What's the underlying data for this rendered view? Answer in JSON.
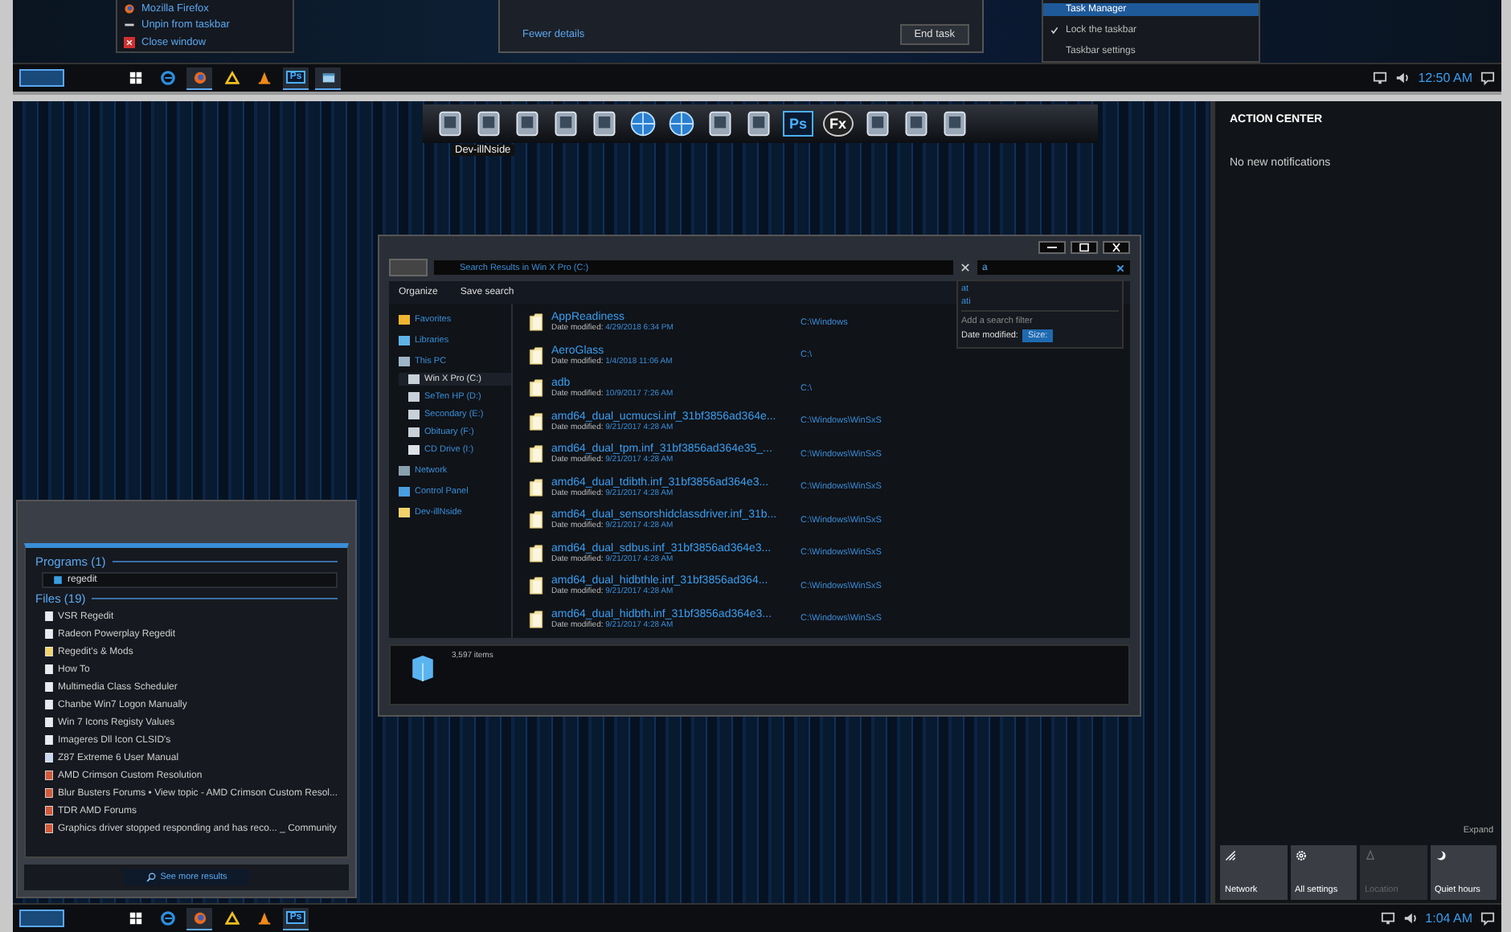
{
  "top_capture": {
    "jump_list": [
      "Mozilla Firefox",
      "Unpin from taskbar",
      "Close window"
    ],
    "task_manager": {
      "fewer_details": "Fewer details",
      "end_task": "End task"
    },
    "context_menu": [
      {
        "label": "Task Manager",
        "selected": true,
        "checked": false
      },
      {
        "label": "Lock the taskbar",
        "selected": false,
        "checked": true
      },
      {
        "label": "Taskbar settings",
        "selected": false,
        "checked": false
      }
    ],
    "taskbar": {
      "apps": [
        {
          "kind": "windows",
          "active": false
        },
        {
          "kind": "edge",
          "active": false
        },
        {
          "kind": "firefox",
          "active": true
        },
        {
          "kind": "triangle",
          "active": false
        },
        {
          "kind": "vlc",
          "active": false
        },
        {
          "kind": "ps",
          "label": "Ps",
          "active": true
        },
        {
          "kind": "window",
          "active": true
        }
      ],
      "clock": "12:50 AM"
    }
  },
  "dock": {
    "label": "Dev-illNside",
    "items": [
      {
        "kind": "app"
      },
      {
        "kind": "app"
      },
      {
        "kind": "app"
      },
      {
        "kind": "app"
      },
      {
        "kind": "app"
      },
      {
        "kind": "globe"
      },
      {
        "kind": "globe"
      },
      {
        "kind": "app"
      },
      {
        "kind": "app"
      },
      {
        "kind": "ps",
        "label": "Ps"
      },
      {
        "kind": "fx",
        "label": "Fx"
      },
      {
        "kind": "app"
      },
      {
        "kind": "app"
      },
      {
        "kind": "app"
      }
    ]
  },
  "explorer": {
    "address": "Search Results in Win X Pro (C:)",
    "search": {
      "value": "a"
    },
    "suggestions": [
      "at",
      "ati"
    ],
    "filter_title": "Add a search filter",
    "filter_label": "Date modified:",
    "filter_option": "Size:",
    "toolbar": [
      "Organize",
      "Save search"
    ],
    "nav": [
      {
        "label": "Favorites",
        "kind": "star",
        "selected": false
      },
      {
        "label": "Libraries",
        "kind": "library",
        "selected": false
      },
      {
        "label": "This PC",
        "kind": "pc",
        "selected": false,
        "children": [
          {
            "label": "Win X Pro (C:)",
            "kind": "drive",
            "selected": true
          },
          {
            "label": "SeTen HP (D:)",
            "kind": "drive",
            "selected": false
          },
          {
            "label": "Secondary (E:)",
            "kind": "drive",
            "selected": false
          },
          {
            "label": "Obituary (F:)",
            "kind": "drive",
            "selected": false
          },
          {
            "label": "CD Drive (I:)",
            "kind": "cd",
            "selected": false
          }
        ]
      },
      {
        "label": "Network",
        "kind": "network",
        "selected": false
      },
      {
        "label": "Control Panel",
        "kind": "panel",
        "selected": false
      },
      {
        "label": "Dev-illNside",
        "kind": "folder",
        "selected": false
      }
    ],
    "files": [
      {
        "name": "AppReadiness",
        "date_label": "Date modified:",
        "date": "4/29/2018 6:34 PM",
        "path": "C:\\Windows"
      },
      {
        "name": "AeroGlass",
        "date_label": "Date modified:",
        "date": "1/4/2018 11:06 AM",
        "path": "C:\\"
      },
      {
        "name": "adb",
        "date_label": "Date modified:",
        "date": "10/9/2017 7:26 AM",
        "path": "C:\\"
      },
      {
        "name": "amd64_dual_ucmucsi.inf_31bf3856ad364e...",
        "date_label": "Date modified:",
        "date": "9/21/2017 4:28 AM",
        "path": "C:\\Windows\\WinSxS"
      },
      {
        "name": "amd64_dual_tpm.inf_31bf3856ad364e35_...",
        "date_label": "Date modified:",
        "date": "9/21/2017 4:28 AM",
        "path": "C:\\Windows\\WinSxS"
      },
      {
        "name": "amd64_dual_tdibth.inf_31bf3856ad364e3...",
        "date_label": "Date modified:",
        "date": "9/21/2017 4:28 AM",
        "path": "C:\\Windows\\WinSxS"
      },
      {
        "name": "amd64_dual_sensorshidclassdriver.inf_31b...",
        "date_label": "Date modified:",
        "date": "9/21/2017 4:28 AM",
        "path": "C:\\Windows\\WinSxS"
      },
      {
        "name": "amd64_dual_sdbus.inf_31bf3856ad364e3...",
        "date_label": "Date modified:",
        "date": "9/21/2017 4:28 AM",
        "path": "C:\\Windows\\WinSxS"
      },
      {
        "name": "amd64_dual_hidbthle.inf_31bf3856ad364...",
        "date_label": "Date modified:",
        "date": "9/21/2017 4:28 AM",
        "path": "C:\\Windows\\WinSxS"
      },
      {
        "name": "amd64_dual_hidbth.inf_31bf3856ad364e3...",
        "date_label": "Date modified:",
        "date": "9/21/2017 4:28 AM",
        "path": "C:\\Windows\\WinSxS"
      }
    ],
    "status": "3,597 items"
  },
  "start_search": {
    "programs_heading": "Programs (1)",
    "programs": [
      "regedit"
    ],
    "files_heading": "Files (19)",
    "files": [
      {
        "name": "VSR Regedit",
        "kind": "page"
      },
      {
        "name": "Radeon Powerplay Regedit",
        "kind": "page"
      },
      {
        "name": "Regedit's & Mods",
        "kind": "folder"
      },
      {
        "name": "How To",
        "kind": "page"
      },
      {
        "name": "Multimedia Class Scheduler",
        "kind": "page"
      },
      {
        "name": "Chanbe Win7 Logon Manually",
        "kind": "page"
      },
      {
        "name": "Win 7 Icons Registy Values",
        "kind": "page"
      },
      {
        "name": "Imageres Dll Icon CLSID's",
        "kind": "page"
      },
      {
        "name": "Z87 Extreme 6 User Manual",
        "kind": "manual"
      },
      {
        "name": "AMD Crimson Custom Resolution",
        "kind": "web"
      },
      {
        "name": "Blur Busters Forums • View topic - AMD Crimson Custom Resol...",
        "kind": "web"
      },
      {
        "name": "TDR AMD Forums",
        "kind": "web"
      },
      {
        "name": "Graphics driver stopped responding and has reco... _ Community",
        "kind": "web"
      }
    ],
    "see_more": "See more results"
  },
  "action_center": {
    "title": "ACTION CENTER",
    "message": "No new notifications",
    "expand": "Expand",
    "tiles": [
      {
        "label": "Network",
        "kind": "network",
        "disabled": false
      },
      {
        "label": "All settings",
        "kind": "gear",
        "disabled": false
      },
      {
        "label": "Location",
        "kind": "location",
        "disabled": true
      },
      {
        "label": "Quiet hours",
        "kind": "moon",
        "disabled": false
      }
    ]
  },
  "taskbar": {
    "apps": [
      {
        "kind": "windows",
        "active": false
      },
      {
        "kind": "edge",
        "active": false
      },
      {
        "kind": "firefox",
        "active": true
      },
      {
        "kind": "triangle",
        "active": false
      },
      {
        "kind": "vlc",
        "active": false
      },
      {
        "kind": "ps",
        "label": "Ps",
        "active": true
      }
    ],
    "clock": "1:04 AM"
  }
}
